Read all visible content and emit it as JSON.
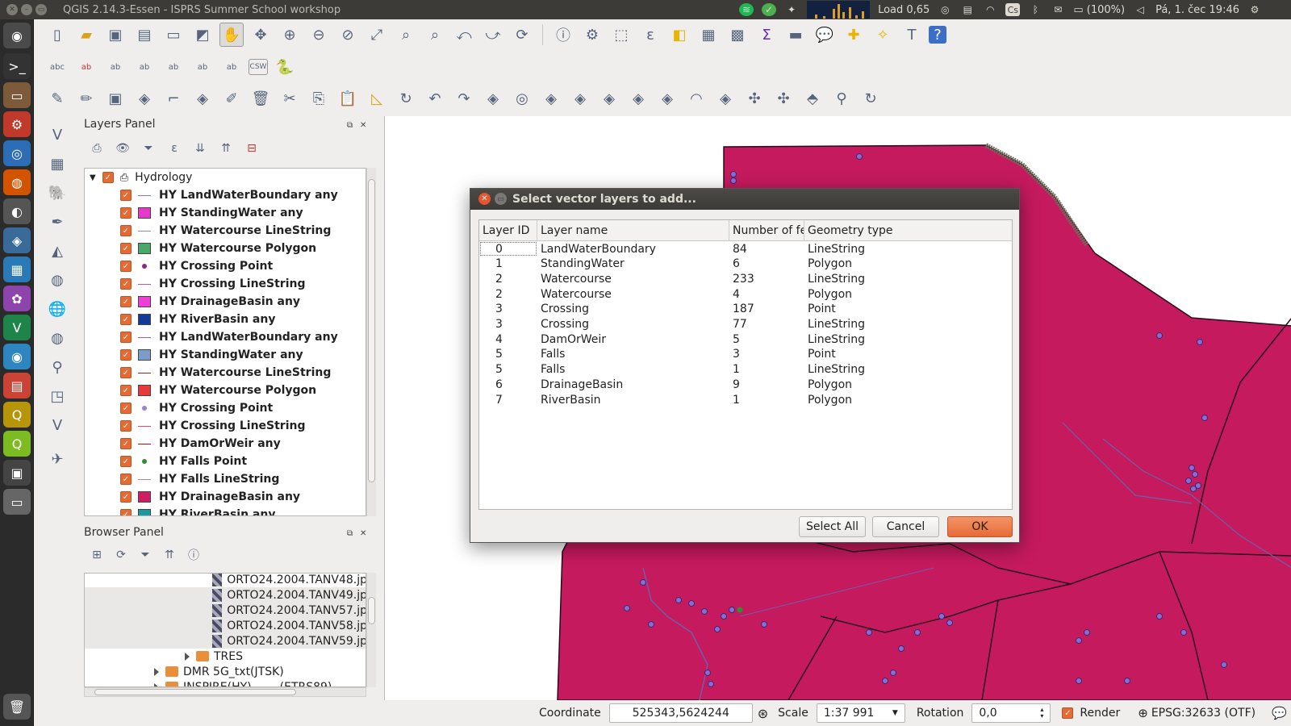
{
  "window": {
    "title": "QGIS 2.14.3-Essen - ISPRS Summer School workshop"
  },
  "tray": {
    "load": "Load 0,65",
    "keyboard": "Cs",
    "battery": "(100%)",
    "clock": "Pá, 1. čec 19:46"
  },
  "layers_panel": {
    "title": "Layers Panel",
    "group": "Hydrology",
    "layers": [
      {
        "name": "HY LandWaterBoundary any",
        "symbol": "line",
        "color": "#9b6fb0"
      },
      {
        "name": "HY StandingWater any",
        "symbol": "box",
        "color": "#e639c8"
      },
      {
        "name": "HY Watercourse LineString",
        "symbol": "line",
        "color": "#8b8fa0"
      },
      {
        "name": "HY Watercourse Polygon",
        "symbol": "box",
        "color": "#4aa86a"
      },
      {
        "name": "HY Crossing Point",
        "symbol": "dot",
        "color": "#8a2a82"
      },
      {
        "name": "HY Crossing LineString",
        "symbol": "line",
        "color": "#b05bb4"
      },
      {
        "name": "HY DrainageBasin any",
        "symbol": "box",
        "color": "#ef3fd6"
      },
      {
        "name": "HY RiverBasin any",
        "symbol": "box",
        "color": "#123a96"
      },
      {
        "name": "HY LandWaterBoundary any",
        "symbol": "line",
        "color": "#a06090"
      },
      {
        "name": "HY StandingWater any",
        "symbol": "box",
        "color": "#7d9cc8"
      },
      {
        "name": "HY Watercourse LineString",
        "symbol": "line",
        "color": "#7a3030"
      },
      {
        "name": "HY Watercourse Polygon",
        "symbol": "box",
        "color": "#e83a3a"
      },
      {
        "name": "HY Crossing Point",
        "symbol": "dot",
        "color": "#9a82d6"
      },
      {
        "name": "HY Crossing LineString",
        "symbol": "line",
        "color": "#d05070"
      },
      {
        "name": "HY DamOrWeir any",
        "symbol": "line",
        "color": "#8a2020"
      },
      {
        "name": "HY Falls Point",
        "symbol": "dot",
        "color": "#2f8f2f"
      },
      {
        "name": "HY Falls LineString",
        "symbol": "line",
        "color": "#c08090"
      },
      {
        "name": "HY DrainageBasin any",
        "symbol": "box",
        "color": "#cf1d64"
      },
      {
        "name": "HY RiverBasin any",
        "symbol": "box",
        "color": "#1a9aa0"
      }
    ]
  },
  "browser_panel": {
    "title": "Browser Panel",
    "items": [
      {
        "label": "ORTO24.2004.TANV48.jp",
        "type": "raster",
        "shade": false
      },
      {
        "label": "ORTO24.2004.TANV49.jp",
        "type": "raster",
        "shade": true
      },
      {
        "label": "ORTO24.2004.TANV57.jp",
        "type": "raster",
        "shade": true
      },
      {
        "label": "ORTO24.2004.TANV58.jp",
        "type": "raster",
        "shade": true
      },
      {
        "label": "ORTO24.2004.TANV59.jp",
        "type": "raster",
        "shade": true
      },
      {
        "label": "TRES",
        "type": "folder",
        "shade": false
      },
      {
        "label": "DMR 5G_txt(JTSK)",
        "type": "folder",
        "shade": false
      },
      {
        "label": "INSPIRE(HY)_____(ETRS89)",
        "type": "folder",
        "shade": false
      }
    ]
  },
  "statusbar": {
    "coordinate_label": "Coordinate",
    "coordinate_value": "525343,5624244",
    "scale_label": "Scale",
    "scale_value": "1:37 991",
    "rotation_label": "Rotation",
    "rotation_value": "0,0",
    "render_label": "Render",
    "crs": "EPSG:32633 (OTF)"
  },
  "dialog": {
    "title": "Select vector layers to add...",
    "columns": [
      "Layer ID",
      "Layer name",
      "Number of fe",
      "Geometry type"
    ],
    "rows": [
      {
        "id": "0",
        "name": "LandWaterBoundary",
        "count": "84",
        "geom": "LineString"
      },
      {
        "id": "1",
        "name": "StandingWater",
        "count": "6",
        "geom": "Polygon"
      },
      {
        "id": "2",
        "name": "Watercourse",
        "count": "233",
        "geom": "LineString"
      },
      {
        "id": "2",
        "name": "Watercourse",
        "count": "4",
        "geom": "Polygon"
      },
      {
        "id": "3",
        "name": "Crossing",
        "count": "187",
        "geom": "Point"
      },
      {
        "id": "3",
        "name": "Crossing",
        "count": "77",
        "geom": "LineString"
      },
      {
        "id": "4",
        "name": "DamOrWeir",
        "count": "5",
        "geom": "LineString"
      },
      {
        "id": "5",
        "name": "Falls",
        "count": "3",
        "geom": "Point"
      },
      {
        "id": "5",
        "name": "Falls",
        "count": "1",
        "geom": "LineString"
      },
      {
        "id": "6",
        "name": "DrainageBasin",
        "count": "9",
        "geom": "Polygon"
      },
      {
        "id": "7",
        "name": "RiverBasin",
        "count": "1",
        "geom": "Polygon"
      }
    ],
    "buttons": {
      "select_all": "Select All",
      "cancel": "Cancel",
      "ok": "OK"
    }
  },
  "map": {
    "basin_color": "#c51a5e",
    "point_color": "#8c6ad8"
  }
}
